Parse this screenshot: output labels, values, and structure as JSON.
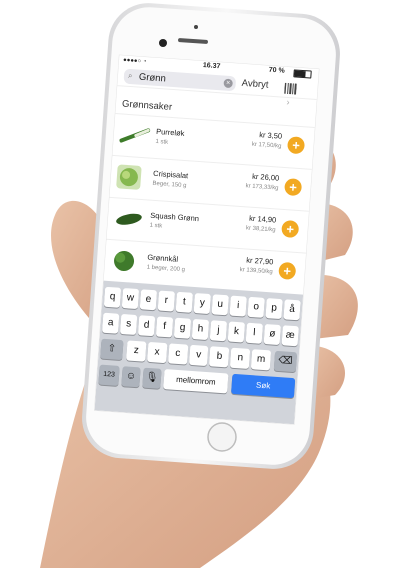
{
  "status_bar": {
    "time": "16.37",
    "battery": "70 %"
  },
  "search": {
    "query": "Grønn",
    "cancel_label": "Avbryt",
    "barcode_icon": "barcode-icon"
  },
  "section": {
    "title": "Grønnsaker"
  },
  "products": [
    {
      "name": "Purreløk",
      "amount": "1 stk",
      "price": "kr 3,50",
      "unit_price": "kr 17,50/kg"
    },
    {
      "name": "Crispisalat",
      "amount": "Beger, 150 g",
      "price": "kr 26,00",
      "unit_price": "kr 173,33/kg"
    },
    {
      "name": "Squash Grønn",
      "amount": "1 stk",
      "price": "kr 14,90",
      "unit_price": "kr 38,21/kg"
    },
    {
      "name": "Grønnkål",
      "amount": "1 beger, 200 g",
      "price": "kr 27,90",
      "unit_price": "kr 139,50/kg"
    }
  ],
  "keyboard": {
    "row1": [
      "q",
      "w",
      "e",
      "r",
      "t",
      "y",
      "u",
      "i",
      "o",
      "p",
      "å"
    ],
    "row2": [
      "a",
      "s",
      "d",
      "f",
      "g",
      "h",
      "j",
      "k",
      "l",
      "ø",
      "æ"
    ],
    "row3": [
      "z",
      "x",
      "c",
      "v",
      "b",
      "n",
      "m"
    ],
    "numbers_label": "123",
    "space_label": "mellomrom",
    "go_label": "Søk"
  },
  "colors": {
    "accent": "#f2a922",
    "go_key": "#2f7cf6"
  }
}
